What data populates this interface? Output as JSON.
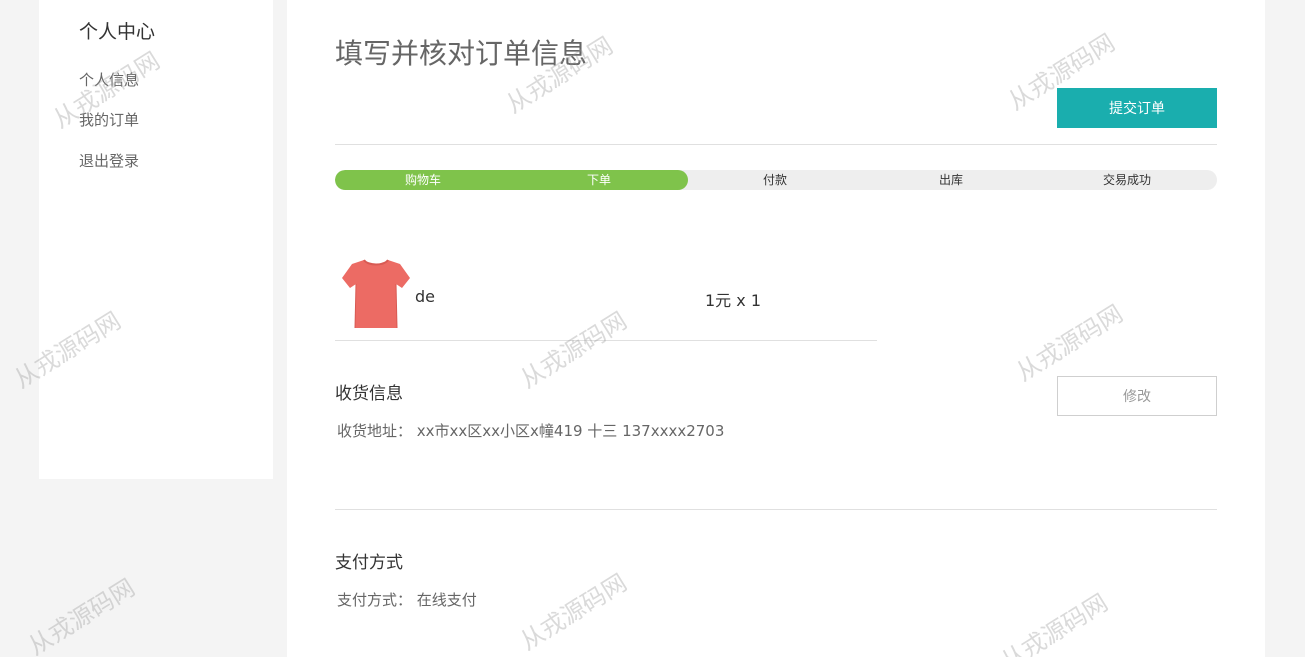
{
  "sidebar": {
    "title": "个人中心",
    "items": [
      {
        "label": "个人信息"
      },
      {
        "label": "我的订单"
      },
      {
        "label": "退出登录"
      }
    ]
  },
  "main": {
    "title": "填写并核对订单信息",
    "submit_label": "提交订单",
    "steps": [
      {
        "label": "购物车"
      },
      {
        "label": "下单"
      },
      {
        "label": "付款"
      },
      {
        "label": "出库"
      },
      {
        "label": "交易成功"
      }
    ],
    "progress_completed_steps": 2,
    "progress_color": "#7fc34b",
    "accent_color": "#1aaeae",
    "product": {
      "image_icon": "tshirt-icon",
      "name": "de",
      "price_qty": "1元 x 1"
    },
    "shipping": {
      "title": "收货信息",
      "address": "收货地址： xx市xx区xx小区x幢419 十三 137xxxx2703",
      "edit_label": "修改"
    },
    "payment": {
      "title": "支付方式",
      "text": "支付方式： 在线支付"
    }
  },
  "watermark": "从戎源码网"
}
